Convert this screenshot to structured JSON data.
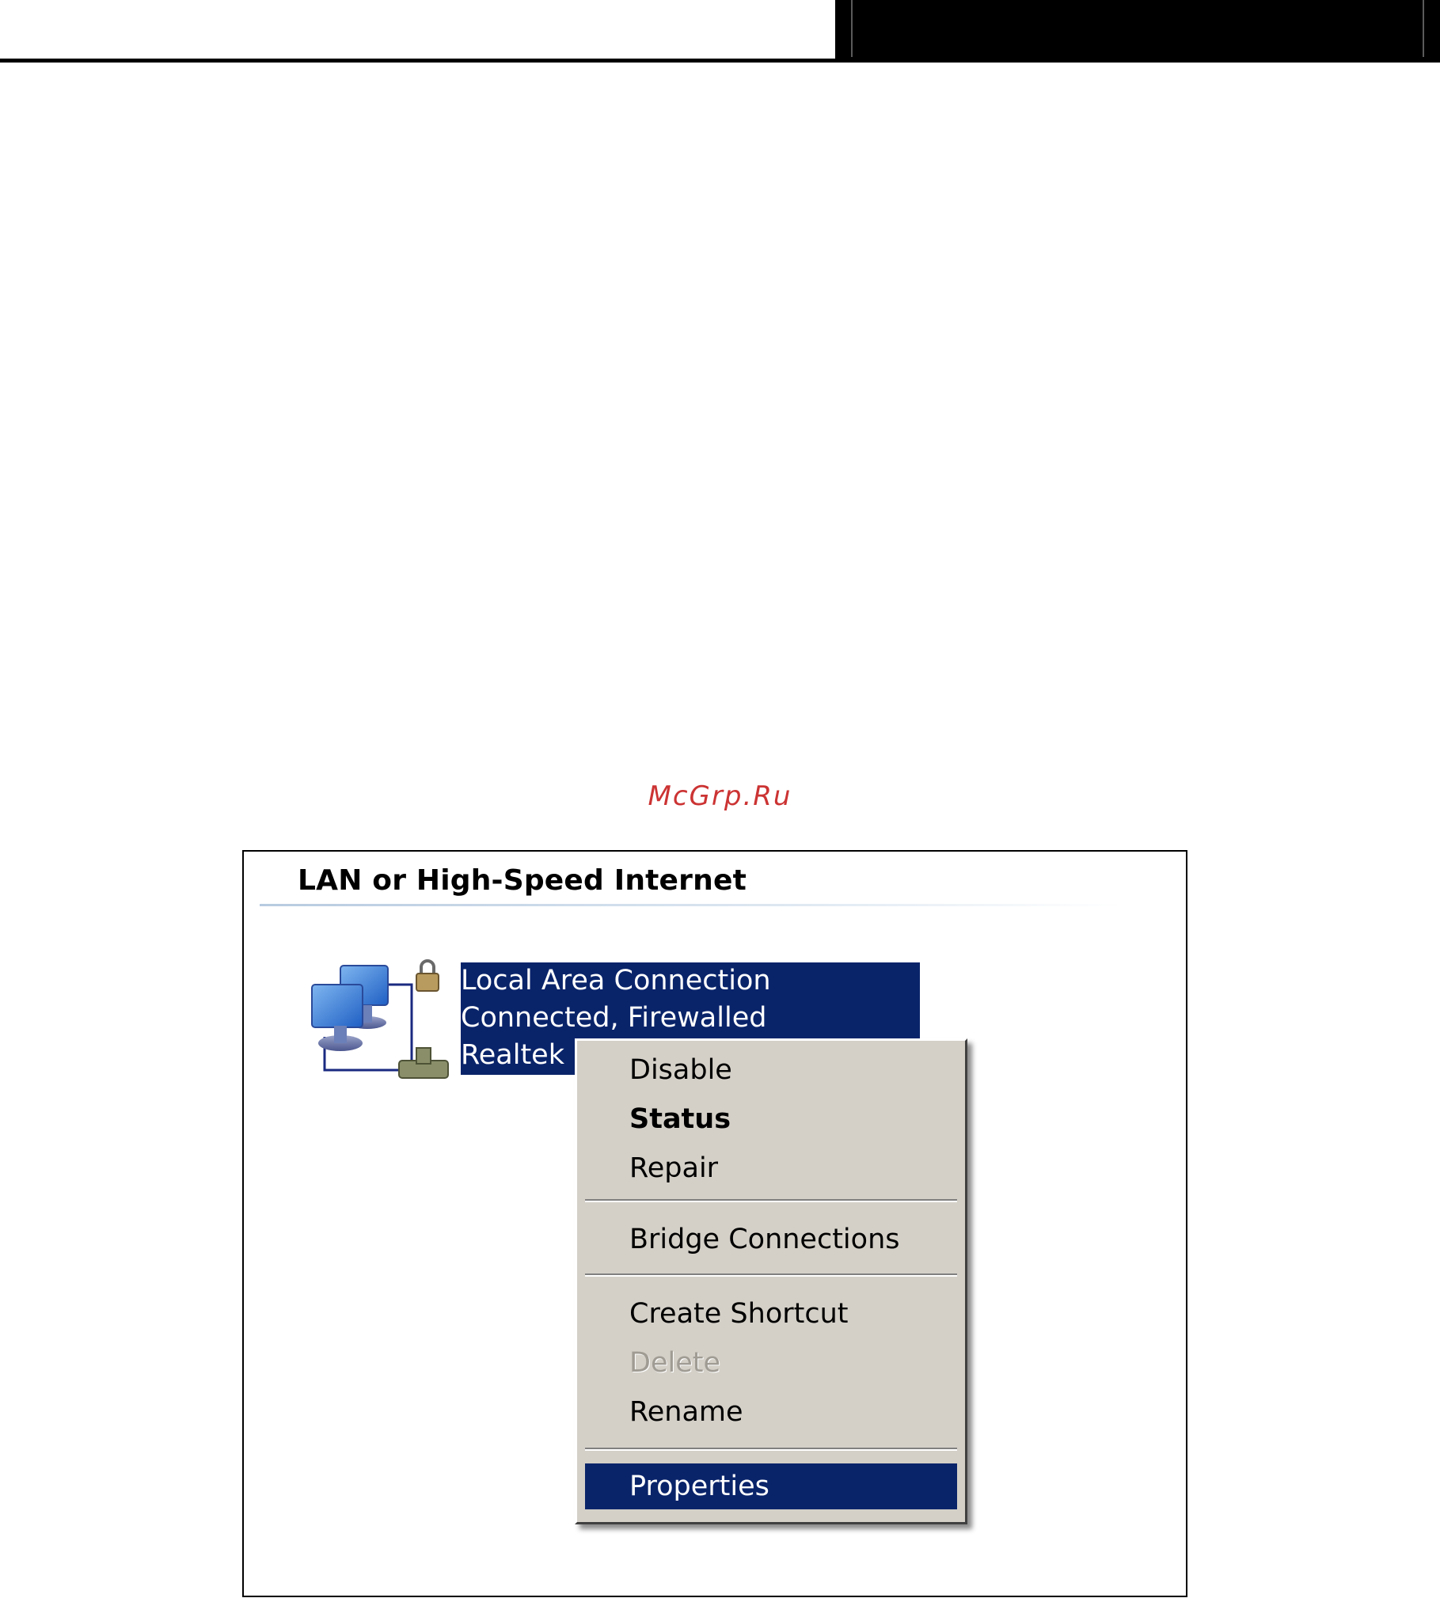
{
  "watermark": "McGrp.Ru",
  "section": {
    "title": "LAN or High-Speed Internet"
  },
  "connection": {
    "name": "Local Area Connection",
    "status": "Connected, Firewalled",
    "device": "Realtek"
  },
  "context_menu": {
    "items": [
      {
        "label": "Disable",
        "state": "normal"
      },
      {
        "label": "Status",
        "state": "default"
      },
      {
        "label": "Repair",
        "state": "normal"
      },
      {
        "label": "Bridge Connections",
        "state": "normal"
      },
      {
        "label": "Create Shortcut",
        "state": "normal"
      },
      {
        "label": "Delete",
        "state": "disabled"
      },
      {
        "label": "Rename",
        "state": "normal"
      },
      {
        "label": "Properties",
        "state": "selected"
      }
    ]
  },
  "colors": {
    "selection": "#0a246a",
    "menu_background": "#d4d0c8",
    "watermark": "#cc3333"
  }
}
